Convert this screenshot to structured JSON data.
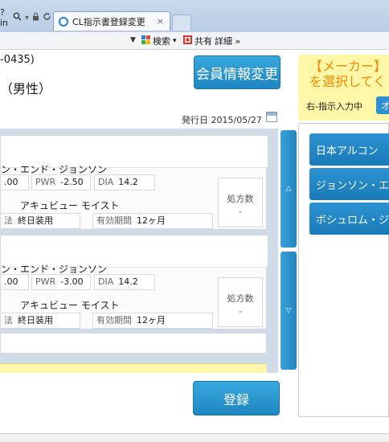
{
  "browser": {
    "address_fragment": "?in",
    "tab_title": "CL指示書登録変更",
    "tab_close": "×",
    "search_label": "検索",
    "share_label": "共有",
    "detail_label": "詳細 »"
  },
  "member": {
    "id_fragment": "-0435)",
    "gender": "（男性）",
    "edit_button": "会員情報変更"
  },
  "maker_panel": {
    "title": "【メーカー】\nを選択してく",
    "status": "右-指示入力中",
    "button": "オ"
  },
  "issue_date": {
    "label": "発行日",
    "value": "2015/05/27"
  },
  "prescriptions": [
    {
      "brand_line1": "ン・エンド・ジョンソン",
      "brand_line2": "アキュビュー モイスト",
      "bc": ".00",
      "pwr_label": "PWR",
      "pwr": "-2.50",
      "dia_label": "DIA",
      "dia": "14.2",
      "wear_label": "法",
      "wear": "終日装用",
      "expiry_label": "有効期間",
      "expiry": "12ヶ月",
      "count_label": "処方数",
      "count": "-"
    },
    {
      "brand_line1": "ン・エンド・ジョンソン",
      "brand_line2": "アキュビュー モイスト",
      "bc": ".00",
      "pwr_label": "PWR",
      "pwr": "-3.00",
      "dia_label": "DIA",
      "dia": "14.2",
      "wear_label": "法",
      "wear": "終日装用",
      "expiry_label": "有効期間",
      "expiry": "12ヶ月",
      "count_label": "処方数",
      "count": "-"
    }
  ],
  "scroll": {
    "up": "△",
    "down": "▽"
  },
  "makers": [
    "日本アルコン",
    "ジョンソン・エンド",
    "ボシュロム・ジャパ"
  ],
  "register_button": "登録",
  "icons": [
    "search-icon",
    "lock-icon",
    "refresh-icon",
    "ie-icon",
    "calendar-icon"
  ]
}
